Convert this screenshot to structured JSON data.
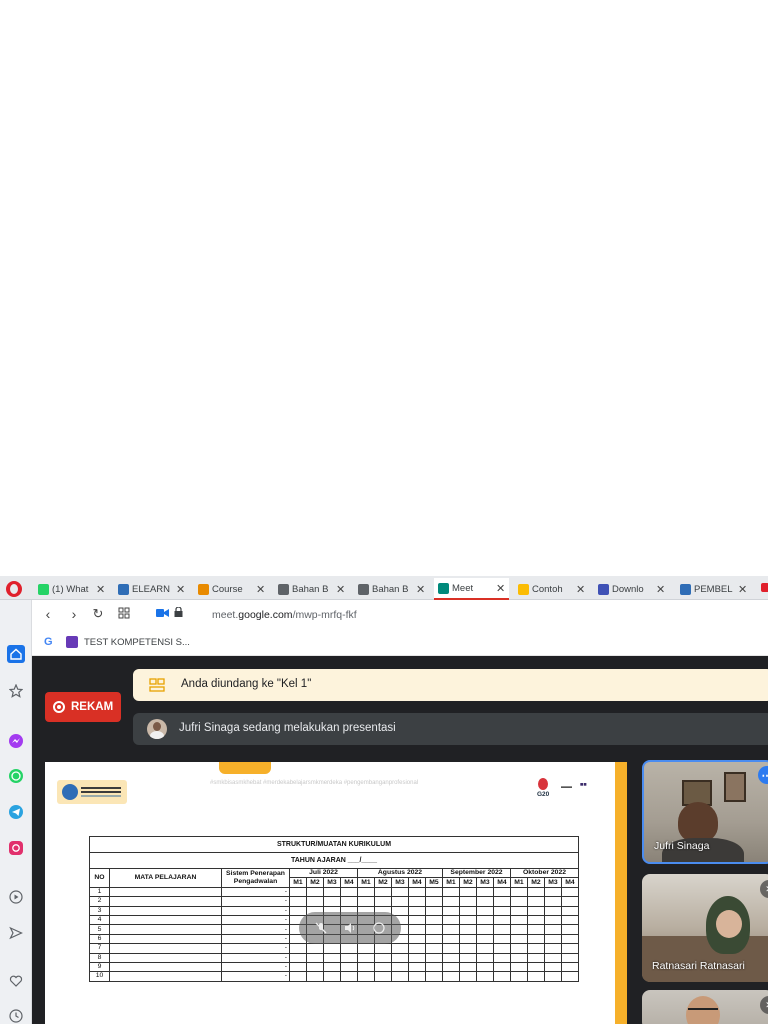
{
  "tabs": [
    {
      "label": "(1) What",
      "icon": "whatsapp-icon",
      "color": "#25d366"
    },
    {
      "label": "ELEARN",
      "icon": "elearning-icon",
      "color": "#2f6db6"
    },
    {
      "label": "Course",
      "icon": "course-icon",
      "color": "#e88a00"
    },
    {
      "label": "Bahan B",
      "icon": "bookmark-icon",
      "color": "#5f6368"
    },
    {
      "label": "Bahan B",
      "icon": "bookmark-icon",
      "color": "#5f6368"
    },
    {
      "label": "Meet",
      "icon": "meet-icon",
      "color": "#00897b"
    },
    {
      "label": "Contoh",
      "icon": "drive-icon",
      "color": "#fbbc04"
    },
    {
      "label": "Downlo",
      "icon": "download-site-icon",
      "color": "#3f51b5"
    },
    {
      "label": "PEMBEL",
      "icon": "elearning-icon",
      "color": "#2f6db6"
    }
  ],
  "address": {
    "url_prefix": "meet.",
    "url_domain": "google.com",
    "url_path": "/mwp-mrfq-fkf"
  },
  "bookmarks": {
    "g_label": "G",
    "item_label": "TEST KOMPETENSI S..."
  },
  "meet": {
    "record_label": "REKAM",
    "invite_text": "Anda diundang ke \"Kel 1\"",
    "presenter_text": "Jufri Sinaga sedang melakukan presentasi",
    "participants": [
      {
        "name": "Jufri Sinaga"
      },
      {
        "name": "Ratnasari Ratnasari"
      },
      {
        "name": ""
      }
    ]
  },
  "slide": {
    "tags": "#smkbisasmkhebat   #merdekabelajarsmkmerdeka   #pengembanganprofesional",
    "g20": "G20",
    "table": {
      "title": "STRUKTUR/MUATAN KURIKULUM",
      "subtitle": "TAHUN AJARAN ___/____",
      "col_no": "NO",
      "col_subject": "MATA PELAJARAN",
      "col_system": "Sistem Penerapan Pengadwalan",
      "months": [
        "Juli 2022",
        "Agustus 2022",
        "September 2022",
        "Oktober 2022"
      ],
      "weeks": [
        [
          "M1",
          "M2",
          "M3",
          "M4"
        ],
        [
          "M1",
          "M2",
          "M3",
          "M4",
          "M5"
        ],
        [
          "M1",
          "M2",
          "M3",
          "M4"
        ],
        [
          "M1",
          "M2",
          "M3",
          "M4"
        ]
      ],
      "rows": [
        "1",
        "2",
        "3",
        "4",
        "5",
        "6",
        "7",
        "8",
        "9",
        "10"
      ],
      "system_mark": "-"
    }
  }
}
